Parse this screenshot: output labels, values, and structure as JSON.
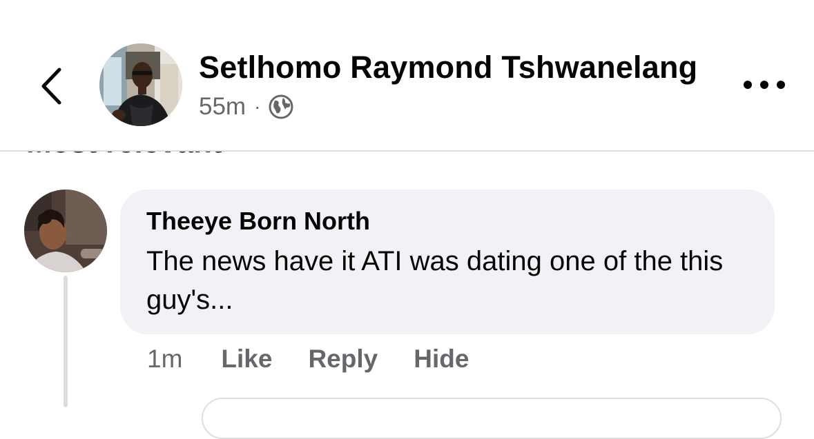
{
  "post": {
    "author_name": "Setlhomo Raymond Tshwanelang",
    "time": "55m",
    "separator": "·",
    "audience_icon": "globe-icon"
  },
  "header_icons": {
    "back": "chevron-left-icon",
    "more": "more-horizontal-icon"
  },
  "comments_sort": {
    "label": "Most relevant"
  },
  "comment": {
    "author": "Theeye Born North",
    "text": "The news have it ATI was dating one of the this guy's...",
    "time": "1m",
    "actions": {
      "like": "Like",
      "reply": "Reply",
      "hide": "Hide"
    }
  },
  "colors": {
    "text_primary": "#050505",
    "text_secondary": "#65676b",
    "bubble_bg": "#f0f2f5",
    "divider": "#dcdde1"
  }
}
